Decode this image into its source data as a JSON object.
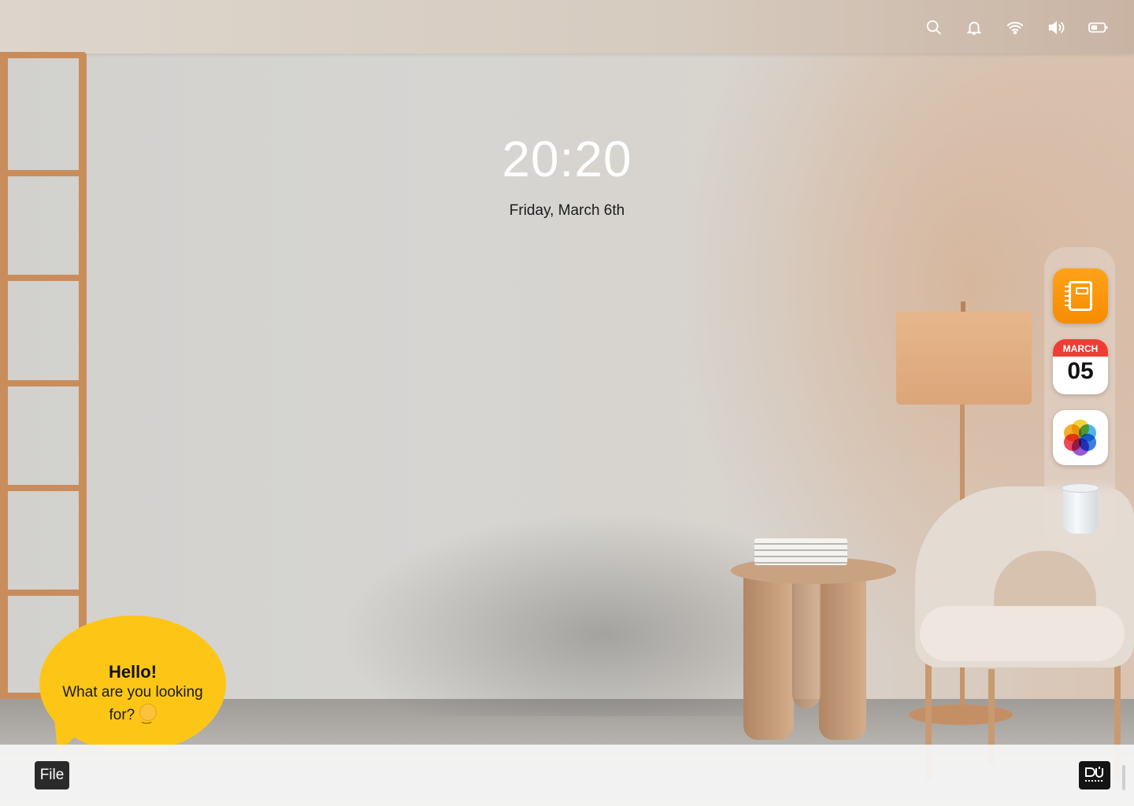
{
  "status_bar": {
    "icons": [
      "search-icon",
      "bell-icon",
      "wifi-icon",
      "volume-icon",
      "battery-icon"
    ]
  },
  "clock": {
    "time": "20:20",
    "date": "Friday, March 6th"
  },
  "dock": {
    "apps": [
      {
        "name": "notes-app",
        "icon": "notebook-icon",
        "color": "#f7980c"
      },
      {
        "name": "calendar-app",
        "month": "MARCH",
        "day": "05",
        "accent": "#ef3d34"
      },
      {
        "name": "photos-app",
        "icon": "photos-icon"
      },
      {
        "name": "trash",
        "icon": "trash-bin-icon"
      }
    ]
  },
  "assistant": {
    "title": "Hello!",
    "message": "What are you looking for?",
    "emoji": "smiling-face-icon",
    "bubble_color": "#fdc617"
  },
  "taskbar": {
    "file_label": "File",
    "logo_icon": "brand-logo-icon"
  }
}
